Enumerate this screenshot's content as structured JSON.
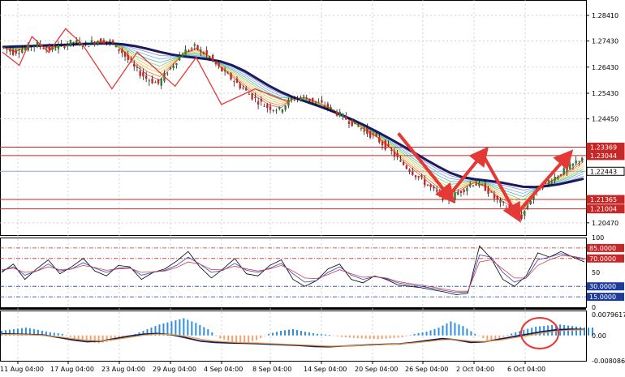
{
  "colors": {
    "background": "#ffffff",
    "grid": "#c0c0c0",
    "up_candle": "#2e7d32",
    "down_candle": "#c62828",
    "wick": "#000000",
    "zigzag": "#e53935",
    "baseline_ma": "#1a1a5e",
    "resistance_line": "#c62828",
    "current_price_line": "#8fa8d8",
    "stoch_main": "#000000",
    "stoch_signal": "#3040c0",
    "stoch_third": "#d04040",
    "level_85": "#c62828",
    "level_30": "#1e3c9c",
    "macd_pos": "#2e8fe0",
    "macd_neg": "#f4a070",
    "macd_line": "#1a1a5e",
    "macd_signal": "#e8a040",
    "annotation": "#e53935"
  },
  "chart_data": [
    {
      "type": "candlestick",
      "panel": "price",
      "x_labels": [
        "11 Aug 04:00",
        "17 Aug 04:00",
        "23 Aug 04:00",
        "29 Aug 04:00",
        "4 Sep 04:00",
        "8 Sep 04:00",
        "14 Sep 04:00",
        "20 Sep 04:00",
        "26 Sep 04:00",
        "2 Oct 04:00",
        "6 Oct 04:00"
      ],
      "y_ticks": [
        "1.28410",
        "1.27430",
        "1.26430",
        "1.25430",
        "1.24450",
        "1.20470"
      ],
      "ylim": [
        1.2,
        1.29
      ],
      "close_path": [
        1.272,
        1.27,
        1.2715,
        1.273,
        1.271,
        1.2725,
        1.274,
        1.273,
        1.2745,
        1.274,
        1.27,
        1.264,
        1.26,
        1.258,
        1.264,
        1.27,
        1.272,
        1.269,
        1.264,
        1.26,
        1.256,
        1.252,
        1.249,
        1.248,
        1.252,
        1.253,
        1.251,
        1.249,
        1.246,
        1.243,
        1.24,
        1.237,
        1.233,
        1.228,
        1.224,
        1.22,
        1.216,
        1.214,
        1.217,
        1.22,
        1.218,
        1.213,
        1.21,
        1.207,
        1.216,
        1.22,
        1.223,
        1.226,
        1.23
      ],
      "ma": [
        1.272,
        1.2722,
        1.2723,
        1.2725,
        1.2727,
        1.2728,
        1.273,
        1.2732,
        1.2733,
        1.2734,
        1.273,
        1.2723,
        1.2713,
        1.2701,
        1.2691,
        1.2684,
        1.2679,
        1.2673,
        1.2665,
        1.265,
        1.2628,
        1.26,
        1.2572,
        1.2548,
        1.2528,
        1.2512,
        1.2496,
        1.2479,
        1.246,
        1.244,
        1.2418,
        1.2394,
        1.2369,
        1.2343,
        1.2316,
        1.2288,
        1.2262,
        1.2238,
        1.2222,
        1.2214,
        1.2209,
        1.2203,
        1.2194,
        1.2185,
        1.2184,
        1.2188,
        1.2195,
        1.2205,
        1.2216
      ],
      "horizontal_levels": [
        {
          "price": 1.23369,
          "label": "1.23369",
          "kind": "resistance"
        },
        {
          "price": 1.23044,
          "label": "1.23044",
          "kind": "resistance"
        },
        {
          "price": 1.22443,
          "label": "1.22443",
          "kind": "current"
        },
        {
          "price": 1.21365,
          "label": "1.21365",
          "kind": "resistance"
        },
        {
          "price": 1.21004,
          "label": "1.21004",
          "kind": "resistance"
        }
      ],
      "zigzag": [
        [
          0,
          1.27
        ],
        [
          4,
          1.265
        ],
        [
          7,
          1.276
        ],
        [
          11,
          1.27
        ],
        [
          15,
          1.279
        ],
        [
          19,
          1.273
        ],
        [
          26,
          1.256
        ],
        [
          32,
          1.27
        ],
        [
          41,
          1.257
        ],
        [
          46,
          1.268
        ],
        [
          52,
          1.25
        ],
        [
          60,
          1.256
        ],
        [
          68,
          1.251
        ]
      ],
      "arrows": [
        [
          [
            94,
            1.239
          ],
          [
            106,
            1.215
          ]
        ],
        [
          [
            106,
            1.215
          ],
          [
            114,
            1.231
          ]
        ],
        [
          [
            114,
            1.231
          ],
          [
            122,
            1.208
          ]
        ],
        [
          [
            122,
            1.208
          ],
          [
            134,
            1.23
          ]
        ]
      ]
    },
    {
      "type": "line",
      "panel": "stochastic",
      "ylim": [
        0,
        100
      ],
      "y_ticks": [
        "100",
        "50",
        "0"
      ],
      "levels": [
        {
          "value": 85,
          "label": "85.0000"
        },
        {
          "value": 70,
          "label": "70.0000"
        },
        {
          "value": 30,
          "label": "30.0000"
        },
        {
          "value": 15,
          "label": "15.0000"
        }
      ],
      "series": [
        {
          "values": [
            50,
            62,
            40,
            55,
            68,
            48,
            58,
            70,
            52,
            45,
            60,
            58,
            40,
            50,
            55,
            66,
            80,
            58,
            42,
            55,
            70,
            48,
            45,
            60,
            68,
            40,
            30,
            38,
            55,
            62,
            40,
            35,
            45,
            40,
            32,
            30,
            28,
            25,
            22,
            18,
            20,
            88,
            70,
            40,
            30,
            45,
            78,
            72,
            80,
            72,
            65
          ]
        },
        {
          "values": [
            52,
            58,
            46,
            52,
            62,
            52,
            55,
            64,
            56,
            50,
            56,
            57,
            46,
            50,
            53,
            60,
            72,
            62,
            50,
            53,
            63,
            53,
            50,
            56,
            63,
            48,
            36,
            38,
            50,
            58,
            46,
            40,
            44,
            41,
            35,
            32,
            30,
            27,
            24,
            21,
            22,
            75,
            72,
            50,
            36,
            42,
            68,
            72,
            77,
            73,
            68
          ]
        },
        {
          "values": [
            54,
            56,
            50,
            52,
            58,
            54,
            55,
            60,
            57,
            53,
            55,
            56,
            50,
            51,
            52,
            57,
            65,
            62,
            54,
            54,
            59,
            55,
            52,
            55,
            60,
            52,
            42,
            41,
            47,
            54,
            48,
            43,
            44,
            42,
            37,
            34,
            32,
            29,
            26,
            23,
            23,
            65,
            68,
            55,
            42,
            42,
            60,
            68,
            74,
            73,
            70
          ]
        }
      ]
    },
    {
      "type": "bar",
      "panel": "macd",
      "ylim": [
        -0.0080865,
        0.0079617
      ],
      "y_ticks": [
        "0.0079617",
        "0.00",
        "-0.0080865"
      ],
      "histogram": [
        0.0015,
        0.002,
        0.0025,
        0.0018,
        0.001,
        0.0005,
        -0.001,
        -0.002,
        -0.0025,
        -0.0018,
        -0.001,
        0.0005,
        0.002,
        0.0035,
        0.0045,
        0.0055,
        0.004,
        0.002,
        -0.001,
        -0.002,
        -0.0025,
        -0.0015,
        0.0005,
        0.0015,
        0.002,
        0.0012,
        0.0005,
        0.0002,
        -0.0005,
        -0.0008,
        -0.001,
        -0.0012,
        -0.0009,
        -0.0006,
        0.0005,
        0.0012,
        0.0025,
        0.0045,
        0.003,
        0.0005,
        -0.0015,
        -0.001,
        0.0006,
        0.0018,
        0.0028,
        0.0032,
        0.0035,
        0.003,
        0.0025
      ],
      "macd_line": [
        0.0005,
        0.0004,
        0.0003,
        0.0001,
        -0.0006,
        -0.0014,
        -0.002,
        -0.0018,
        -0.001,
        -0.0002,
        0.0004,
        0.0006,
        0.0002,
        -0.0008,
        -0.0018,
        -0.0022,
        -0.0024,
        -0.0025,
        -0.0026,
        -0.0028,
        -0.003,
        -0.0032,
        -0.0035,
        -0.0036,
        -0.0034,
        -0.0032,
        -0.003,
        -0.0028,
        -0.0027,
        -0.0022,
        -0.0016,
        -0.001,
        -0.0014,
        -0.0022,
        -0.002,
        -0.0012,
        -0.0004,
        0.0004,
        0.0012,
        0.0018,
        0.002,
        0.0019
      ],
      "signal_line": [
        0.0003,
        0.0003,
        0.0002,
        0.0,
        -0.0004,
        -0.001,
        -0.0016,
        -0.0017,
        -0.0013,
        -0.0006,
        0.0001,
        0.0004,
        0.0003,
        -0.0003,
        -0.0012,
        -0.0018,
        -0.0021,
        -0.0023,
        -0.0024,
        -0.0026,
        -0.0028,
        -0.003,
        -0.0032,
        -0.0034,
        -0.0034,
        -0.0033,
        -0.0031,
        -0.0029,
        -0.0027,
        -0.0024,
        -0.0019,
        -0.0014,
        -0.0013,
        -0.0018,
        -0.0019,
        -0.0015,
        -0.0008,
        -0.0001,
        0.0007,
        0.0013,
        0.0017,
        0.0018
      ]
    }
  ]
}
